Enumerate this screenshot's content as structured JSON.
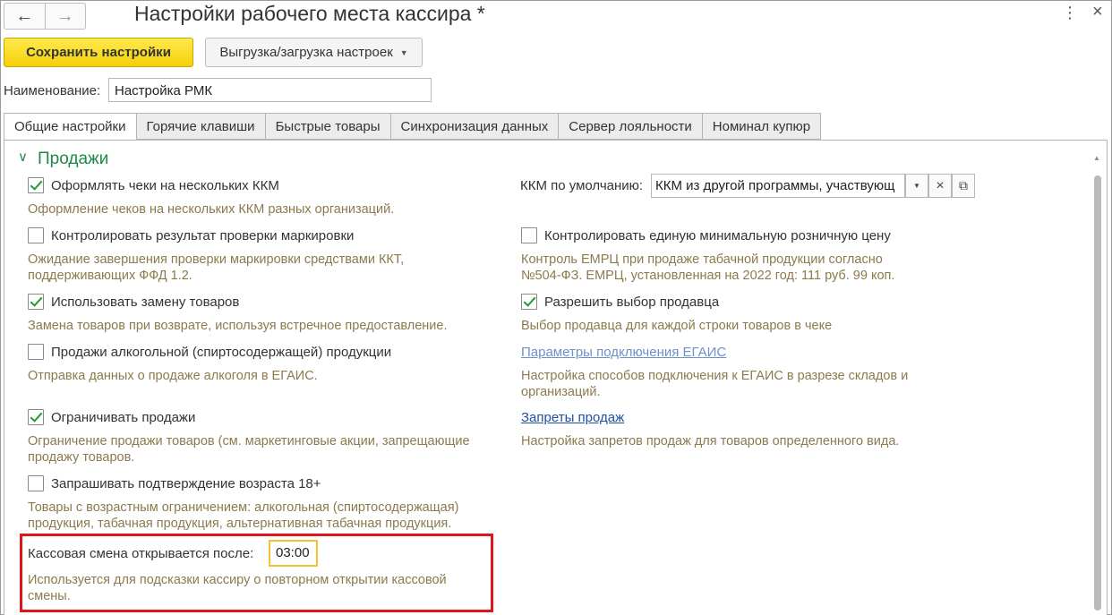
{
  "window": {
    "title": "Настройки рабочего места кассира *",
    "back_icon": "←",
    "forward_icon": "→",
    "more_icon": "⋮",
    "close_icon": "×"
  },
  "toolbar": {
    "save_label": "Сохранить настройки",
    "export_label": "Выгрузка/загрузка настроек",
    "export_caret": "▼"
  },
  "name": {
    "label": "Наименование:",
    "value": "Настройка РМК"
  },
  "tabs": [
    {
      "label": "Общие настройки",
      "active": true
    },
    {
      "label": "Горячие клавиши"
    },
    {
      "label": "Быстрые товары"
    },
    {
      "label": "Синхронизация данных"
    },
    {
      "label": "Сервер лояльности"
    },
    {
      "label": "Номинал купюр"
    }
  ],
  "group": {
    "title": "Продажи",
    "chevron": "∨"
  },
  "left": {
    "multi_kkm": {
      "label": "Оформлять чеки на нескольких ККМ",
      "checked": true,
      "hint": "Оформление чеков на нескольких ККМ разных организаций."
    },
    "marking": {
      "label": "Контролировать результат проверки маркировки",
      "checked": false,
      "hint_1": "Ожидание завершения проверки маркировки средствами ККТ,",
      "hint_2": "поддерживающих ФФД 1.2."
    },
    "replace": {
      "label": "Использовать замену товаров",
      "checked": true,
      "hint": "Замена товаров при возврате, используя встречное предоставление."
    },
    "alcohol": {
      "label": "Продажи алкогольной (спиртосодержащей) продукции",
      "checked": false,
      "hint": "Отправка данных о продаже алкоголя в ЕГАИС."
    },
    "restrict": {
      "label": "Ограничивать продажи",
      "checked": true,
      "hint_1": "Ограничение продажи товаров (см. маркетинговые акции, запрещающие",
      "hint_2": "продажу товаров."
    },
    "age": {
      "label": "Запрашивать подтверждение возраста 18+",
      "checked": false,
      "hint_1": "Товары с возрастным ограничением: алкогольная (спиртосодержащая)",
      "hint_2": "продукция, табачная продукция, альтернативная табачная продукция."
    }
  },
  "right": {
    "kkm_default": {
      "label": "ККМ по умолчанию:",
      "value": "ККМ из другой программы, участвующ",
      "dropdown_icon": "▼",
      "clear_icon": "×",
      "open_icon": "⧉"
    },
    "min_price": {
      "label": "Контролировать единую минимальную розничную цену",
      "checked": false,
      "hint_1": "Контроль ЕМРЦ при продаже табачной продукции согласно",
      "hint_2": "№504-ФЗ. ЕМРЦ, установленная на 2022 год: 111 руб. 99 коп."
    },
    "seller": {
      "label": "Разрешить выбор продавца",
      "checked": true,
      "hint": "Выбор продавца для каждой строки товаров в чеке"
    },
    "egais_link": {
      "label": "Параметры подключения ЕГАИС",
      "hint_1": "Настройка способов подключения к ЕГАИС в разрезе складов и",
      "hint_2": "организаций."
    },
    "bans_link": {
      "label": "Запреты продаж",
      "hint": "Настройка запретов продаж для товаров определенного вида."
    }
  },
  "shift": {
    "label": "Кассовая смена открывается после:",
    "value": "03:00",
    "hint_1": "Используется для подсказки кассиру о повторном открытии кассовой",
    "hint_2": "смены."
  },
  "colors": {
    "accent_green": "#1d8a46",
    "save_yellow": "#f5d00a",
    "highlight_red": "#e0141b",
    "hint_text": "#8c7a4d",
    "link_blue": "#1f4fa8"
  }
}
